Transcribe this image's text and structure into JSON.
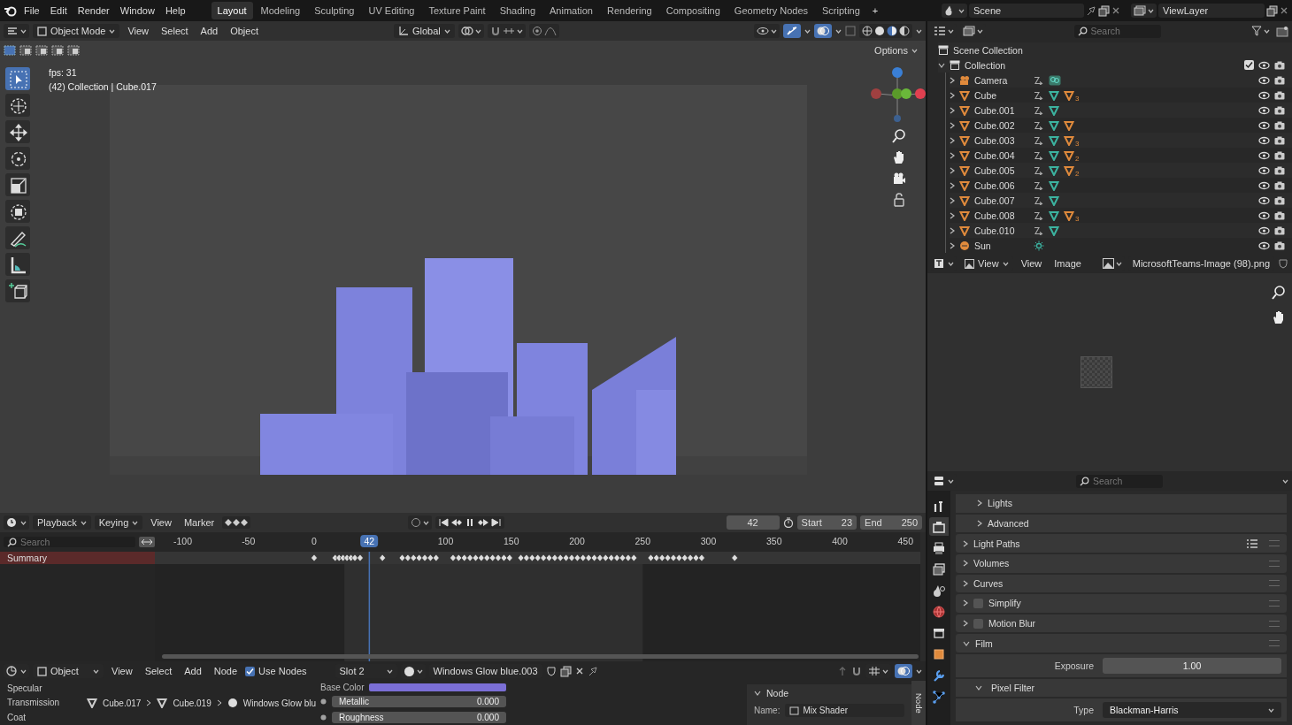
{
  "topbar": {
    "menus": [
      "File",
      "Edit",
      "Render",
      "Window",
      "Help"
    ],
    "workspaces": [
      {
        "label": "Layout",
        "selected": true
      },
      {
        "label": "Modeling",
        "selected": false
      },
      {
        "label": "Sculpting",
        "selected": false
      },
      {
        "label": "UV Editing",
        "selected": false
      },
      {
        "label": "Texture Paint",
        "selected": false
      },
      {
        "label": "Shading",
        "selected": false
      },
      {
        "label": "Animation",
        "selected": false
      },
      {
        "label": "Rendering",
        "selected": false
      },
      {
        "label": "Compositing",
        "selected": false
      },
      {
        "label": "Geometry Nodes",
        "selected": false
      },
      {
        "label": "Scripting",
        "selected": false
      }
    ],
    "add_tab": "+",
    "scene": "Scene",
    "view_layer": "ViewLayer"
  },
  "viewport": {
    "mode": "Object Mode",
    "menus": [
      "View",
      "Select",
      "Add",
      "Object"
    ],
    "orientation": "Global",
    "options": "Options",
    "fps": "fps: 31",
    "context": "(42) Collection | Cube.017",
    "tools": [
      {
        "kind": "select",
        "selected": true
      },
      {
        "kind": "cursor",
        "selected": false
      },
      {
        "kind": "move",
        "selected": false
      },
      {
        "kind": "rotate",
        "selected": false
      },
      {
        "kind": "scale",
        "selected": false
      },
      {
        "kind": "transform",
        "selected": false
      },
      {
        "kind": "annotate",
        "selected": false
      },
      {
        "kind": "measure",
        "selected": false
      },
      {
        "kind": "add-cube",
        "selected": false
      }
    ]
  },
  "timeline": {
    "menus": [
      "Playback",
      "Keying",
      "View",
      "Marker"
    ],
    "current_frame": "42",
    "start_label": "Start",
    "start": "23",
    "end_label": "End",
    "end": "250",
    "search_placeholder": "Search",
    "frame_badge": "42",
    "ruler": [
      "-100",
      "-50",
      "0",
      "100",
      "150",
      "200",
      "250",
      "300",
      "350",
      "400",
      "450"
    ],
    "channel": "Summary"
  },
  "node_editor": {
    "editor": "Object",
    "menus": [
      "View",
      "Select",
      "Add",
      "Node"
    ],
    "use_nodes": {
      "label": "Use Nodes",
      "checked": true
    },
    "slot": "Slot 2",
    "material": "Windows Glow blue.003",
    "sockets": [
      "Specular",
      "Transmission",
      "Coat"
    ],
    "breadcrumbs": [
      "Cube.017",
      "Cube.019",
      "Windows Glow blu"
    ],
    "base_color": "Base Color",
    "fields": [
      {
        "label": "Metallic",
        "value": "0.000"
      },
      {
        "label": "Roughness",
        "value": "0.000"
      }
    ],
    "panel": {
      "title": "Node",
      "name_label": "Name:",
      "name": "Mix Shader",
      "tab": "Node"
    }
  },
  "outliner": {
    "search_placeholder": "Search",
    "root": "Scene Collection",
    "collection": {
      "name": "Collection",
      "expanded": true,
      "checked": true,
      "children": [
        {
          "name": "Camera",
          "kind": "camera",
          "expanded": false
        },
        {
          "name": "Cube",
          "kind": "mesh",
          "expanded": false,
          "material": true,
          "count": "3"
        },
        {
          "name": "Cube.001",
          "kind": "mesh",
          "expanded": false,
          "material": false
        },
        {
          "name": "Cube.002",
          "kind": "mesh",
          "expanded": false,
          "material": true
        },
        {
          "name": "Cube.003",
          "kind": "mesh",
          "expanded": false,
          "material": true,
          "count": "3"
        },
        {
          "name": "Cube.004",
          "kind": "mesh",
          "expanded": false,
          "material": true,
          "count": "2"
        },
        {
          "name": "Cube.005",
          "kind": "mesh",
          "expanded": false,
          "material": true,
          "count": "2"
        },
        {
          "name": "Cube.006",
          "kind": "mesh",
          "expanded": false,
          "material": false
        },
        {
          "name": "Cube.007",
          "kind": "mesh",
          "expanded": false,
          "material": false
        },
        {
          "name": "Cube.008",
          "kind": "mesh",
          "expanded": false,
          "material": true,
          "count": "3"
        },
        {
          "name": "Cube.010",
          "kind": "mesh",
          "expanded": false,
          "material": false
        },
        {
          "name": "Sun",
          "kind": "light",
          "expanded": false
        }
      ]
    }
  },
  "image_editor": {
    "menus": [
      "View",
      "Image"
    ],
    "view": "View",
    "image": "MicrosoftTeams-Image (98).png"
  },
  "properties": {
    "search_placeholder": "Search",
    "tabs": [
      {
        "kind": "tool",
        "selected": false
      },
      {
        "kind": "render",
        "selected": true
      },
      {
        "kind": "output",
        "selected": false
      },
      {
        "kind": "view-layer",
        "selected": false
      },
      {
        "kind": "scene",
        "selected": false
      },
      {
        "kind": "world",
        "selected": false
      },
      {
        "kind": "collection",
        "selected": false
      },
      {
        "kind": "object",
        "selected": false
      },
      {
        "kind": "modifier",
        "selected": false
      },
      {
        "kind": "particles",
        "selected": false
      }
    ],
    "panels": [
      {
        "label": "Lights",
        "kind": "subpanel",
        "expanded": false,
        "presets": false
      },
      {
        "label": "Advanced",
        "kind": "subpanel",
        "expanded": false,
        "presets": false
      },
      {
        "label": "Light Paths",
        "kind": "panel",
        "expanded": false,
        "presets": true
      },
      {
        "label": "Volumes",
        "kind": "panel",
        "expanded": false,
        "presets": false
      },
      {
        "label": "Curves",
        "kind": "panel",
        "expanded": false,
        "presets": false
      },
      {
        "label": "Simplify",
        "kind": "toggle",
        "checked": false,
        "expanded": false,
        "presets": false
      },
      {
        "label": "Motion Blur",
        "kind": "toggle",
        "checked": false,
        "expanded": false,
        "presets": false
      },
      {
        "label": "Film",
        "kind": "panel",
        "expanded": true,
        "presets": false
      }
    ],
    "film": {
      "exposure_label": "Exposure",
      "exposure": "1.00",
      "pixel_filter": "Pixel Filter",
      "pixel_filter_expanded": true,
      "type_label": "Type",
      "type": "Blackman-Harris"
    }
  }
}
